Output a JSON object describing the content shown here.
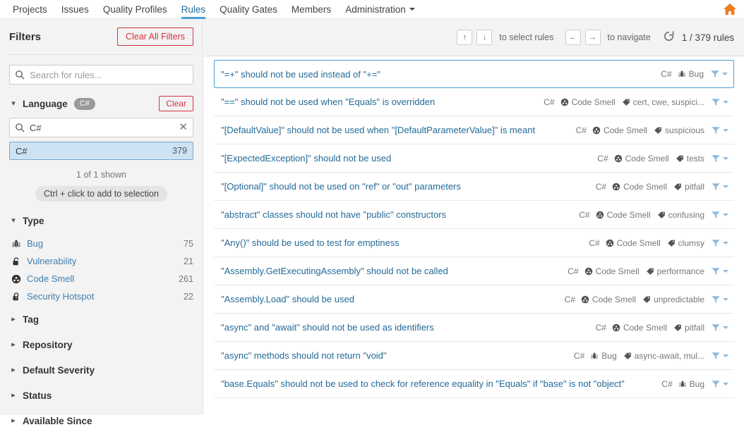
{
  "topnav": {
    "items": [
      {
        "label": "Projects",
        "active": false
      },
      {
        "label": "Issues",
        "active": false
      },
      {
        "label": "Quality Profiles",
        "active": false
      },
      {
        "label": "Rules",
        "active": true
      },
      {
        "label": "Quality Gates",
        "active": false
      },
      {
        "label": "Members",
        "active": false
      },
      {
        "label": "Administration",
        "active": false,
        "caret": true
      }
    ],
    "home_icon": "home-icon"
  },
  "sidebar": {
    "title": "Filters",
    "clear_all_label": "Clear All Filters",
    "search": {
      "placeholder": "Search for rules...",
      "value": "",
      "icon": "search-icon"
    },
    "language_facet": {
      "name": "Language",
      "badge": "C#",
      "clear_label": "Clear",
      "search_value": "C#",
      "search_icon": "search-icon",
      "clear_icon": "close-icon",
      "options": [
        {
          "label": "C#",
          "count": "379",
          "selected": true
        }
      ],
      "shown_note": "1 of 1 shown",
      "ctrl_hint": "Ctrl + click to add to selection"
    },
    "type_facet": {
      "name": "Type",
      "items": [
        {
          "label": "Bug",
          "count": "75",
          "icon": "bug-icon"
        },
        {
          "label": "Vulnerability",
          "count": "21",
          "icon": "vulnerability-icon"
        },
        {
          "label": "Code Smell",
          "count": "261",
          "icon": "code-smell-icon"
        },
        {
          "label": "Security Hotspot",
          "count": "22",
          "icon": "security-hotspot-icon"
        }
      ]
    },
    "collapsed_facets": [
      {
        "label": "Tag"
      },
      {
        "label": "Repository"
      },
      {
        "label": "Default Severity"
      },
      {
        "label": "Status"
      },
      {
        "label": "Available Since"
      }
    ]
  },
  "toolbar": {
    "key_up": "↑",
    "key_down": "↓",
    "select_hint": "to select rules",
    "key_left": "←",
    "key_right": "→",
    "navigate_hint": "to navigate",
    "reload_icon": "reload-icon",
    "rules_count": "1 / 379 rules"
  },
  "rules": [
    {
      "title": "\"=+\" should not be used instead of \"+=\"",
      "lang": "C#",
      "type": "Bug",
      "type_icon": "bug-icon",
      "tags": "",
      "selected": true
    },
    {
      "title": "\"==\" should not be used when \"Equals\" is overridden",
      "lang": "C#",
      "type": "Code Smell",
      "type_icon": "code-smell-icon",
      "tags": "cert, cwe, suspici...",
      "selected": false
    },
    {
      "title": "\"[DefaultValue]\" should not be used when \"[DefaultParameterValue]\" is meant",
      "lang": "C#",
      "type": "Code Smell",
      "type_icon": "code-smell-icon",
      "tags": "suspicious",
      "selected": false
    },
    {
      "title": "\"[ExpectedException]\" should not be used",
      "lang": "C#",
      "type": "Code Smell",
      "type_icon": "code-smell-icon",
      "tags": "tests",
      "selected": false
    },
    {
      "title": "\"[Optional]\" should not be used on \"ref\" or \"out\" parameters",
      "lang": "C#",
      "type": "Code Smell",
      "type_icon": "code-smell-icon",
      "tags": "pitfall",
      "selected": false
    },
    {
      "title": "\"abstract\" classes should not have \"public\" constructors",
      "lang": "C#",
      "type": "Code Smell",
      "type_icon": "code-smell-icon",
      "tags": "confusing",
      "selected": false
    },
    {
      "title": "\"Any()\" should be used to test for emptiness",
      "lang": "C#",
      "type": "Code Smell",
      "type_icon": "code-smell-icon",
      "tags": "clumsy",
      "selected": false
    },
    {
      "title": "\"Assembly.GetExecutingAssembly\" should not be called",
      "lang": "C#",
      "type": "Code Smell",
      "type_icon": "code-smell-icon",
      "tags": "performance",
      "selected": false
    },
    {
      "title": "\"Assembly.Load\" should be used",
      "lang": "C#",
      "type": "Code Smell",
      "type_icon": "code-smell-icon",
      "tags": "unpredictable",
      "selected": false
    },
    {
      "title": "\"async\" and \"await\" should not be used as identifiers",
      "lang": "C#",
      "type": "Code Smell",
      "type_icon": "code-smell-icon",
      "tags": "pitfall",
      "selected": false
    },
    {
      "title": "\"async\" methods should not return \"void\"",
      "lang": "C#",
      "type": "Bug",
      "type_icon": "bug-icon",
      "tags": "async-await, mul...",
      "selected": false
    },
    {
      "title": "\"base.Equals\" should not be used to check for reference equality in \"Equals\" if \"base\" is not \"object\"",
      "lang": "C#",
      "type": "Bug",
      "type_icon": "bug-icon",
      "tags": "",
      "selected": false
    }
  ],
  "colors": {
    "accent_blue": "#4b9fd5",
    "link_blue": "#236a97",
    "danger_red": "#d4333f",
    "home_orange": "#ed7d20",
    "sidebar_bg": "#f3f3f3",
    "selected_option_bg": "#cde3f4"
  }
}
